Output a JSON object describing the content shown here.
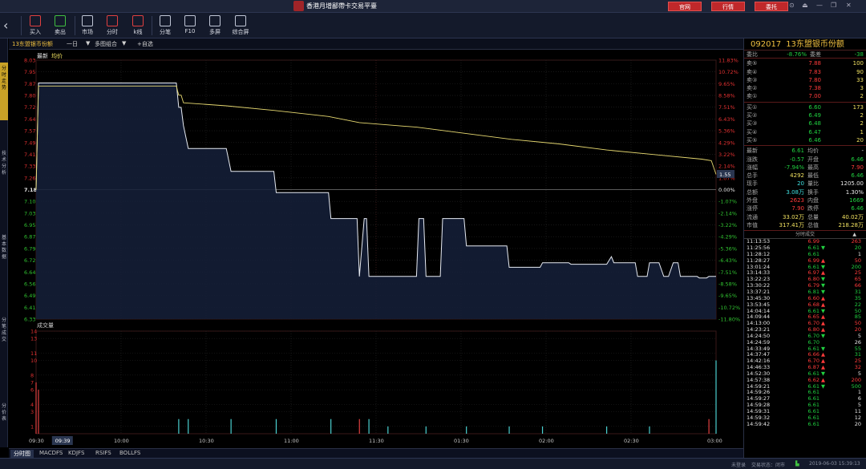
{
  "titlebar": {
    "title": "香港月增鄙帶卡交易平臺",
    "buttons": [
      {
        "label": "官网",
        "color": "#c0282a"
      },
      {
        "label": "行情",
        "color": "#c0282a"
      },
      {
        "label": "委托",
        "color": "#c0282a"
      }
    ],
    "controls": [
      "⊙",
      "⏏",
      "—",
      "❐",
      "✕"
    ]
  },
  "toolbar": {
    "tools": [
      {
        "label": "买入",
        "icon": "buy-house-icon",
        "color": "#e04040"
      },
      {
        "label": "卖出",
        "icon": "sell-house-icon",
        "color": "#40c040"
      },
      {
        "label": "市场",
        "icon": "market-icon",
        "color": "#c0c6d6"
      },
      {
        "label": "分时",
        "icon": "timeshare-icon",
        "color": "#c0c6d6"
      },
      {
        "label": "k线",
        "icon": "kline-icon",
        "color": "#e04040"
      },
      {
        "label": "分笔",
        "icon": "tick-icon",
        "color": "#c0c6d6"
      },
      {
        "label": "F10",
        "icon": "document-icon",
        "color": "#c0c6d6"
      },
      {
        "label": "多屏",
        "icon": "multiscreen-icon",
        "color": "#c0c6d6"
      },
      {
        "label": "综合屏",
        "icon": "grid-icon",
        "color": "#c0c6d6"
      }
    ]
  },
  "left_tabs": [
    {
      "label": "分时走势",
      "active": true
    },
    {
      "label": "技术分析",
      "active": false
    },
    {
      "label": "基本数据",
      "active": false
    },
    {
      "label": "分笔成交",
      "active": false
    },
    {
      "label": "分价表",
      "active": false
    }
  ],
  "chart_header": {
    "stock": "13东盟银币份额",
    "period": "一日",
    "mode": "多图组合",
    "add": "+自选",
    "legend_latest": "最新",
    "legend_avg": "均价",
    "volume_label": "成交量"
  },
  "chart_data": {
    "type": "line",
    "prev_close": 7.18,
    "price_ticks": [
      "8.03",
      "7.95",
      "7.87",
      "7.80",
      "7.72",
      "7.64",
      "7.57",
      "7.49",
      "7.41",
      "7.33",
      "7.26",
      "7.18",
      "7.10",
      "7.03",
      "6.95",
      "6.87",
      "6.79",
      "6.72",
      "6.64",
      "6.56",
      "6.49",
      "6.41",
      "6.33"
    ],
    "pct_ticks": [
      "11.83%",
      "10.72%",
      "9.65%",
      "8.58%",
      "7.51%",
      "6.43%",
      "5.36%",
      "4.29%",
      "3.22%",
      "2.14%",
      "1.07%",
      "0.00%",
      "-1.07%",
      "-2.14%",
      "-3.22%",
      "-4.29%",
      "-5.36%",
      "-6.43%",
      "-7.51%",
      "-8.58%",
      "-9.65%",
      "-10.72%",
      "-11.80%"
    ],
    "time_ticks": [
      "09:30",
      "10:00",
      "10:30",
      "11:00",
      "11:30",
      "01:30",
      "02:00",
      "02:30",
      "03:00"
    ],
    "crosshair_time": "09:39",
    "crosshair_pct": "1.55",
    "volume_ticks": [
      "14",
      "13",
      "11",
      "10",
      "8",
      "7",
      "6",
      "4",
      "3",
      "1"
    ],
    "volume_ylim": [
      0,
      14
    ],
    "price_ylim": [
      6.33,
      8.03
    ],
    "price_series": [
      {
        "t": 0,
        "v": 7.18
      },
      {
        "t": 1,
        "v": 7.88
      },
      {
        "t": 59,
        "v": 7.88
      },
      {
        "t": 60,
        "v": 7.72
      },
      {
        "t": 61,
        "v": 7.72
      },
      {
        "t": 62,
        "v": 7.6
      },
      {
        "t": 64,
        "v": 7.45
      },
      {
        "t": 80,
        "v": 7.45
      },
      {
        "t": 82,
        "v": 7.3
      },
      {
        "t": 100,
        "v": 7.3
      },
      {
        "t": 101,
        "v": 7.16
      },
      {
        "t": 123,
        "v": 7.16
      },
      {
        "t": 124,
        "v": 6.99
      },
      {
        "t": 135,
        "v": 6.99
      },
      {
        "t": 136,
        "v": 6.61
      },
      {
        "t": 138,
        "v": 6.99
      },
      {
        "t": 139,
        "v": 6.99
      },
      {
        "t": 140,
        "v": 6.61
      },
      {
        "t": 160,
        "v": 6.61
      },
      {
        "t": 161,
        "v": 6.99
      },
      {
        "t": 163,
        "v": 6.99
      },
      {
        "t": 164,
        "v": 6.61
      },
      {
        "t": 170,
        "v": 6.61
      },
      {
        "t": 171,
        "v": 6.99
      },
      {
        "t": 180,
        "v": 6.99
      },
      {
        "t": 181,
        "v": 6.81
      },
      {
        "t": 198,
        "v": 6.81
      },
      {
        "t": 199,
        "v": 6.67
      },
      {
        "t": 212,
        "v": 6.67
      },
      {
        "t": 213,
        "v": 6.7
      },
      {
        "t": 224,
        "v": 6.7
      },
      {
        "t": 225,
        "v": 6.69
      },
      {
        "t": 240,
        "v": 6.69
      },
      {
        "t": 242,
        "v": 6.74
      },
      {
        "t": 243,
        "v": 6.7
      },
      {
        "t": 252,
        "v": 6.7
      },
      {
        "t": 253,
        "v": 6.61
      },
      {
        "t": 257,
        "v": 6.61
      },
      {
        "t": 258,
        "v": 6.7
      },
      {
        "t": 262,
        "v": 6.7
      },
      {
        "t": 264,
        "v": 6.61
      },
      {
        "t": 266,
        "v": 6.61
      },
      {
        "t": 268,
        "v": 6.7
      },
      {
        "t": 270,
        "v": 6.7
      },
      {
        "t": 271,
        "v": 6.61
      },
      {
        "t": 278,
        "v": 6.61
      },
      {
        "t": 279,
        "v": 6.6
      },
      {
        "t": 282,
        "v": 6.6
      },
      {
        "t": 283,
        "v": 6.61
      },
      {
        "t": 284,
        "v": 6.61
      },
      {
        "t": 286,
        "v": 6.61
      }
    ],
    "avg_series": [
      {
        "t": 0,
        "v": 7.18
      },
      {
        "t": 1,
        "v": 7.86
      },
      {
        "t": 59,
        "v": 7.86
      },
      {
        "t": 60,
        "v": 7.8
      },
      {
        "t": 61,
        "v": 7.8
      },
      {
        "t": 62,
        "v": 7.75
      },
      {
        "t": 80,
        "v": 7.73
      },
      {
        "t": 100,
        "v": 7.7
      },
      {
        "t": 123,
        "v": 7.66
      },
      {
        "t": 136,
        "v": 7.62
      },
      {
        "t": 160,
        "v": 7.59
      },
      {
        "t": 180,
        "v": 7.55
      },
      {
        "t": 200,
        "v": 7.51
      },
      {
        "t": 220,
        "v": 7.48
      },
      {
        "t": 240,
        "v": 7.44
      },
      {
        "t": 260,
        "v": 7.41
      },
      {
        "t": 280,
        "v": 7.38
      },
      {
        "t": 284,
        "v": 7.37
      },
      {
        "t": 286,
        "v": 7.28
      }
    ],
    "volume_bars": [
      {
        "t": 0,
        "v": 7,
        "c": "#e04040"
      },
      {
        "t": 1,
        "v": 6,
        "c": "#e04040"
      },
      {
        "t": 60,
        "v": 2,
        "c": "#4ad0d0"
      },
      {
        "t": 64,
        "v": 2,
        "c": "#4ad0d0"
      },
      {
        "t": 82,
        "v": 2,
        "c": "#4ad0d0"
      },
      {
        "t": 101,
        "v": 2,
        "c": "#4ad0d0"
      },
      {
        "t": 124,
        "v": 2,
        "c": "#4ad0d0"
      },
      {
        "t": 136,
        "v": 2,
        "c": "#e04040"
      },
      {
        "t": 140,
        "v": 2,
        "c": "#4ad0d0"
      },
      {
        "t": 148,
        "v": 1,
        "c": "#4ad0d0"
      },
      {
        "t": 164,
        "v": 1,
        "c": "#4ad0d0"
      },
      {
        "t": 181,
        "v": 1,
        "c": "#4ad0d0"
      },
      {
        "t": 199,
        "v": 1,
        "c": "#4ad0d0"
      },
      {
        "t": 213,
        "v": 1,
        "c": "#4ad0d0"
      },
      {
        "t": 240,
        "v": 1,
        "c": "#4ad0d0"
      },
      {
        "t": 258,
        "v": 1,
        "c": "#4ad0d0"
      },
      {
        "t": 283,
        "v": 2,
        "c": "#e04040"
      },
      {
        "t": 286,
        "v": 10,
        "c": "#4ad0d0"
      }
    ]
  },
  "quote": {
    "code": "092017",
    "name": "13东盟银币份额",
    "weibi": {
      "label": "委比",
      "pct": "-8.76%",
      "label2": "委差",
      "diff": "-38"
    },
    "asks": [
      {
        "label": "卖⑤",
        "price": "7.88",
        "vol": "100"
      },
      {
        "label": "卖④",
        "price": "7.83",
        "vol": "90"
      },
      {
        "label": "卖③",
        "price": "7.80",
        "vol": "33"
      },
      {
        "label": "卖②",
        "price": "7.38",
        "vol": "3"
      },
      {
        "label": "卖①",
        "price": "7.00",
        "vol": "2"
      }
    ],
    "bids": [
      {
        "label": "买①",
        "price": "6.60",
        "vol": "173"
      },
      {
        "label": "买②",
        "price": "6.49",
        "vol": "2"
      },
      {
        "label": "买③",
        "price": "6.48",
        "vol": "2"
      },
      {
        "label": "买④",
        "price": "6.47",
        "vol": "1"
      },
      {
        "label": "买⑤",
        "price": "6.46",
        "vol": "20"
      }
    ],
    "stats": [
      {
        "l1": "最新",
        "v1": "6.61",
        "c1": "green",
        "l2": "均价",
        "v2": "-",
        "c2": "white"
      },
      {
        "l1": "涨跌",
        "v1": "-0.57",
        "c1": "green",
        "l2": "开盘",
        "v2": "6.46",
        "c2": "green"
      },
      {
        "l1": "涨幅",
        "v1": "-7.94%",
        "c1": "green",
        "l2": "最高",
        "v2": "7.90",
        "c2": "red"
      },
      {
        "l1": "总手",
        "v1": "4292",
        "c1": "yellow",
        "l2": "最低",
        "v2": "6.46",
        "c2": "green"
      },
      {
        "l1": "现手",
        "v1": "20",
        "c1": "cyan",
        "l2": "量比",
        "v2": "1205.00",
        "c2": "white"
      },
      {
        "l1": "总额",
        "v1": "3.08万",
        "c1": "cyan",
        "l2": "换手",
        "v2": "1.30%",
        "c2": "white"
      },
      {
        "l1": "外盘",
        "v1": "2623",
        "c1": "red",
        "l2": "内盘",
        "v2": "1669",
        "c2": "green"
      },
      {
        "l1": "涨停",
        "v1": "7.90",
        "c1": "red",
        "l2": "跌停",
        "v2": "6.46",
        "c2": "green"
      },
      {
        "l1": "流通",
        "v1": "33.02万",
        "c1": "yellow",
        "l2": "总量",
        "v2": "40.02万",
        "c2": "yellow"
      },
      {
        "l1": "市值",
        "v1": "317.41万",
        "c1": "yellow",
        "l2": "总值",
        "v2": "218.28万",
        "c2": "yellow"
      }
    ]
  },
  "trades": {
    "title": "分时成交",
    "rows": [
      {
        "time": "11:13:53",
        "price": "6.99",
        "pc": "red",
        "dir": "",
        "vol": "263",
        "vc": "red"
      },
      {
        "time": "11:25:56",
        "price": "6.61",
        "pc": "green",
        "dir": "▼",
        "vol": "20",
        "vc": "green"
      },
      {
        "time": "11:28:12",
        "price": "6.61",
        "pc": "green",
        "dir": "",
        "vol": "1",
        "vc": "white"
      },
      {
        "time": "11:28:27",
        "price": "6.99",
        "pc": "red",
        "dir": "▲",
        "vol": "50",
        "vc": "red"
      },
      {
        "time": "13:01:24",
        "price": "6.61",
        "pc": "green",
        "dir": "▼",
        "vol": "200",
        "vc": "green"
      },
      {
        "time": "13:14:33",
        "price": "6.97",
        "pc": "red",
        "dir": "▲",
        "vol": "25",
        "vc": "red"
      },
      {
        "time": "13:22:23",
        "price": "6.80",
        "pc": "red",
        "dir": "▼",
        "vol": "65",
        "vc": "red"
      },
      {
        "time": "13:30:22",
        "price": "6.79",
        "pc": "red",
        "dir": "▼",
        "vol": "66",
        "vc": "red"
      },
      {
        "time": "13:37:21",
        "price": "6.81",
        "pc": "green",
        "dir": "▼",
        "vol": "31",
        "vc": "green"
      },
      {
        "time": "13:45:30",
        "price": "6.60",
        "pc": "red",
        "dir": "▲",
        "vol": "35",
        "vc": "green"
      },
      {
        "time": "13:53:45",
        "price": "6.68",
        "pc": "red",
        "dir": "▲",
        "vol": "22",
        "vc": "green"
      },
      {
        "time": "14:04:14",
        "price": "6.61",
        "pc": "green",
        "dir": "▼",
        "vol": "50",
        "vc": "green"
      },
      {
        "time": "14:09:44",
        "price": "6.65",
        "pc": "red",
        "dir": "▲",
        "vol": "85",
        "vc": "green"
      },
      {
        "time": "14:13:00",
        "price": "6.70",
        "pc": "red",
        "dir": "▲",
        "vol": "50",
        "vc": "red"
      },
      {
        "time": "14:23:21",
        "price": "6.80",
        "pc": "red",
        "dir": "▲",
        "vol": "20",
        "vc": "red"
      },
      {
        "time": "14:24:50",
        "price": "6.70",
        "pc": "green",
        "dir": "▼",
        "vol": "5",
        "vc": "white"
      },
      {
        "time": "14:24:59",
        "price": "6.70",
        "pc": "green",
        "dir": "",
        "vol": "26",
        "vc": "white"
      },
      {
        "time": "14:33:49",
        "price": "6.61",
        "pc": "green",
        "dir": "▼",
        "vol": "55",
        "vc": "green"
      },
      {
        "time": "14:37:47",
        "price": "6.66",
        "pc": "red",
        "dir": "▲",
        "vol": "31",
        "vc": "green"
      },
      {
        "time": "14:42:16",
        "price": "6.70",
        "pc": "red",
        "dir": "▲",
        "vol": "25",
        "vc": "red"
      },
      {
        "time": "14:46:33",
        "price": "6.87",
        "pc": "red",
        "dir": "▲",
        "vol": "32",
        "vc": "red"
      },
      {
        "time": "14:52:30",
        "price": "6.61",
        "pc": "green",
        "dir": "▼",
        "vol": "5",
        "vc": "white"
      },
      {
        "time": "14:57:38",
        "price": "6.62",
        "pc": "red",
        "dir": "▲",
        "vol": "200",
        "vc": "red"
      },
      {
        "time": "14:59:21",
        "price": "6.61",
        "pc": "green",
        "dir": "▼",
        "vol": "500",
        "vc": "green"
      },
      {
        "time": "14:59:26",
        "price": "6.61",
        "pc": "green",
        "dir": "",
        "vol": "1",
        "vc": "white"
      },
      {
        "time": "14:59:27",
        "price": "6.61",
        "pc": "green",
        "dir": "",
        "vol": "6",
        "vc": "white"
      },
      {
        "time": "14:59:28",
        "price": "6.61",
        "pc": "green",
        "dir": "",
        "vol": "5",
        "vc": "white"
      },
      {
        "time": "14:59:31",
        "price": "6.61",
        "pc": "green",
        "dir": "",
        "vol": "11",
        "vc": "white"
      },
      {
        "time": "14:59:32",
        "price": "6.61",
        "pc": "green",
        "dir": "",
        "vol": "12",
        "vc": "white"
      },
      {
        "time": "14:59:42",
        "price": "6.61",
        "pc": "green",
        "dir": "",
        "vol": "20",
        "vc": "white"
      }
    ]
  },
  "bottom_tabs": [
    {
      "label": "分时图",
      "active": true
    },
    {
      "label": "MACDFS",
      "active": false
    },
    {
      "label": "KDJFS",
      "active": false
    },
    {
      "label": "RSIFS",
      "active": false
    },
    {
      "label": "BOLLFS",
      "active": false
    }
  ],
  "status": {
    "user": "未登录",
    "state": "交易状态：闭市",
    "datetime": "2019-06-03 15:39:13"
  }
}
